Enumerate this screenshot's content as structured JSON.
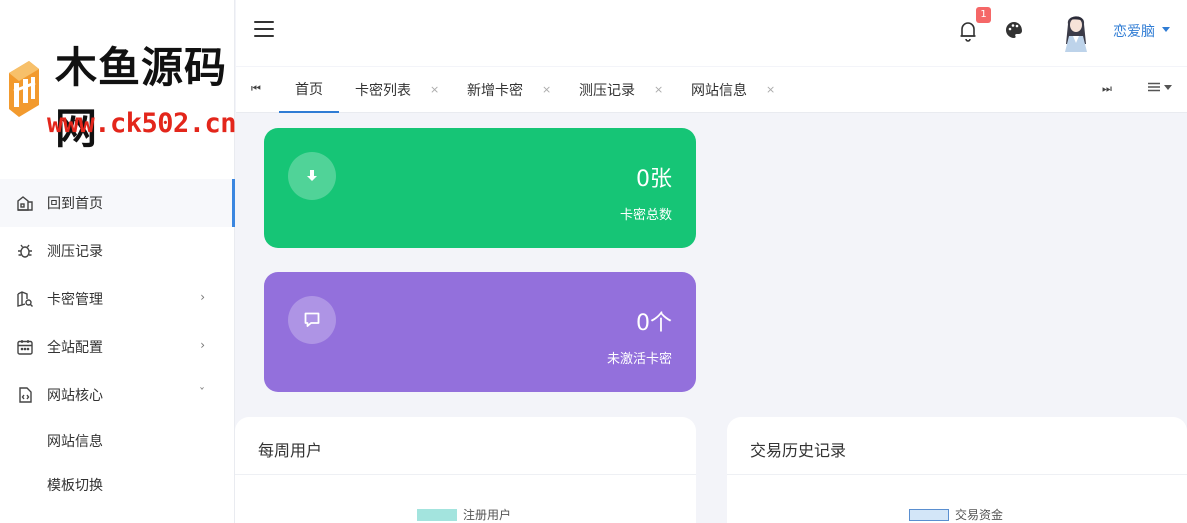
{
  "logo": {
    "title": "木鱼源码网",
    "url": "www.ck502.cn"
  },
  "sidebar": {
    "items": [
      {
        "label": "回到首页",
        "icon": "home-icon",
        "active": true
      },
      {
        "label": "测压记录",
        "icon": "bug-icon"
      },
      {
        "label": "卡密管理",
        "icon": "map-search-icon",
        "arrow": "›"
      },
      {
        "label": "全站配置",
        "icon": "calendar-icon",
        "arrow": "›"
      },
      {
        "label": "网站核心",
        "icon": "code-file-icon",
        "arrow": "ˇ"
      }
    ],
    "subitems": [
      {
        "label": "网站信息"
      },
      {
        "label": "模板切换"
      }
    ]
  },
  "header": {
    "notification_count": "1",
    "username": "恋爱脑"
  },
  "tabs": {
    "first_icon": "⏮",
    "last_icon": "⏭",
    "items": [
      {
        "label": "首页",
        "active": true
      },
      {
        "label": "卡密列表",
        "close": "×"
      },
      {
        "label": "新增卡密",
        "close": "×"
      },
      {
        "label": "测压记录",
        "close": "×"
      },
      {
        "label": "网站信息",
        "close": "×"
      }
    ]
  },
  "cards": [
    {
      "value": "0张",
      "label": "卡密总数",
      "icon": "download-icon",
      "color": "#16c576"
    },
    {
      "value": "0个",
      "label": "未激活卡密",
      "icon": "message-icon",
      "color": "#9370dc"
    }
  ],
  "panels": [
    {
      "title": "每周用户",
      "legend": "注册用户",
      "legend_color": "#a3e4de"
    },
    {
      "title": "交易历史记录",
      "legend": "交易资金",
      "legend_color": "#d3e6f8"
    }
  ]
}
